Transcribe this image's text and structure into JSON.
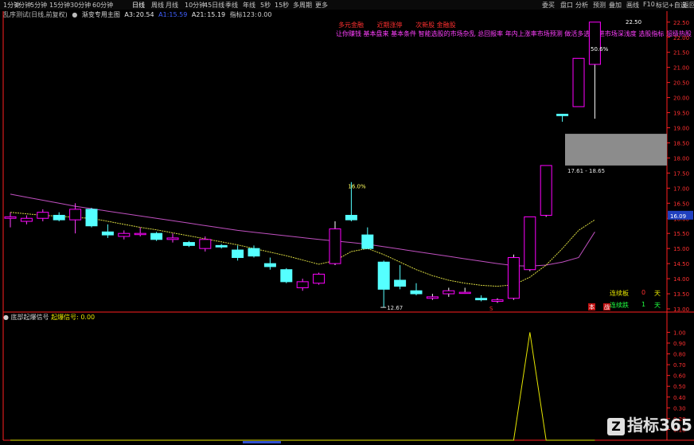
{
  "top_bar": {
    "left_tabs": [
      "1分钟",
      "1分钟",
      "5分钟",
      "15分钟",
      "30分钟",
      "60分钟",
      "日线",
      "周线",
      "月线",
      "10分钟",
      "45日线",
      "季线",
      "年线",
      "5秒",
      "15秒",
      "多周期",
      "更多"
    ],
    "right_tabs": [
      "委买",
      "盘口",
      "分析",
      "预测",
      "叠加",
      "画线",
      "F10",
      "标记",
      "+自选",
      "返回"
    ]
  },
  "title_bar": {
    "stock_name": "乱序测试(日线,前复权)",
    "indicator_name": "渐变专用主图",
    "a3_label": "A3:",
    "a3_value": "20.54",
    "mid_value": "A1:15.59",
    "a21_label": "A21:",
    "a21_value": "15.19",
    "label_four": "指标123:",
    "value_four": "0.00"
  },
  "annotations": {
    "row1": [
      "多元金融",
      "近期涨停",
      "次新股 金融股"
    ],
    "row2": "让你赚钱 基本盘来 基本条件 智能选股的市场杂乱 总回报率 年内上涨率市场预测 做活多选 就进市场深浅度 选股指标 超级热股"
  },
  "sub_panel": {
    "title": "底部起爆信号",
    "label": "起爆信号:",
    "value": "0.00"
  },
  "stats": {
    "limit_up_label": "连续板",
    "limit_up_value": "0",
    "limit_up_unit": "天",
    "limit_down_label": "连续跌",
    "limit_down_value": "1",
    "limit_down_unit": "天"
  },
  "markers": {
    "s_label": "S",
    "ben_label": "本",
    "jie_label": "战"
  },
  "logo": {
    "icon": "Z",
    "text": "指标365"
  },
  "colors": {
    "up": "#ff00ff",
    "down": "#55ffff",
    "ma_slow": "#c050c0",
    "ma_fast": "#d8d840",
    "gray_box": "#8c8c8c",
    "axis": "#ff2020",
    "signal": "#e6e600"
  },
  "chart_data": [
    {
      "type": "candlestick",
      "title": "渐变专用主图",
      "y_ticks": [
        "22.50",
        "22.00",
        "21.50",
        "21.00",
        "20.50",
        "20.00",
        "19.50",
        "19.00",
        "18.50",
        "18.00",
        "17.50",
        "17.00",
        "16.50",
        "16.00",
        "15.50",
        "15.00",
        "14.50",
        "14.00",
        "13.50",
        "13.00"
      ],
      "ylim": [
        13.0,
        22.6
      ],
      "last_price_label": "16.09",
      "candles": [
        {
          "o": 16.0,
          "h": 16.2,
          "l": 15.7,
          "c": 16.05
        },
        {
          "o": 15.9,
          "h": 16.1,
          "l": 15.8,
          "c": 16.0
        },
        {
          "o": 16.0,
          "h": 16.3,
          "l": 15.9,
          "c": 16.2
        },
        {
          "o": 16.1,
          "h": 16.2,
          "l": 15.9,
          "c": 15.95
        },
        {
          "o": 15.95,
          "h": 16.5,
          "l": 15.5,
          "c": 16.3
        },
        {
          "o": 16.3,
          "h": 16.35,
          "l": 15.7,
          "c": 15.75
        },
        {
          "o": 15.55,
          "h": 15.8,
          "l": 15.35,
          "c": 15.45
        },
        {
          "o": 15.4,
          "h": 15.6,
          "l": 15.3,
          "c": 15.5
        },
        {
          "o": 15.5,
          "h": 15.7,
          "l": 15.4,
          "c": 15.5
        },
        {
          "o": 15.5,
          "h": 15.55,
          "l": 15.25,
          "c": 15.3
        },
        {
          "o": 15.3,
          "h": 15.5,
          "l": 15.2,
          "c": 15.35
        },
        {
          "o": 15.2,
          "h": 15.25,
          "l": 15.05,
          "c": 15.1
        },
        {
          "o": 15.0,
          "h": 15.4,
          "l": 14.9,
          "c": 15.3
        },
        {
          "o": 15.1,
          "h": 15.15,
          "l": 15.0,
          "c": 15.05
        },
        {
          "o": 14.95,
          "h": 15.1,
          "l": 14.6,
          "c": 14.7
        },
        {
          "o": 15.0,
          "h": 15.1,
          "l": 14.7,
          "c": 14.75
        },
        {
          "o": 14.5,
          "h": 14.7,
          "l": 14.3,
          "c": 14.4
        },
        {
          "o": 14.3,
          "h": 14.35,
          "l": 13.85,
          "c": 13.9
        },
        {
          "o": 13.7,
          "h": 14.0,
          "l": 13.6,
          "c": 13.9
        },
        {
          "o": 13.85,
          "h": 14.2,
          "l": 13.8,
          "c": 14.15
        },
        {
          "o": 14.5,
          "h": 15.9,
          "l": 14.45,
          "c": 15.65
        },
        {
          "o": 16.1,
          "h": 17.2,
          "l": 15.9,
          "c": 15.95
        },
        {
          "o": 15.45,
          "h": 15.7,
          "l": 15.0,
          "c": 15.0
        },
        {
          "o": 14.55,
          "h": 14.6,
          "l": 13.05,
          "c": 13.65
        },
        {
          "o": 13.95,
          "h": 14.45,
          "l": 13.65,
          "c": 13.75
        },
        {
          "o": 13.6,
          "h": 13.85,
          "l": 13.45,
          "c": 13.5
        },
        {
          "o": 13.35,
          "h": 13.5,
          "l": 13.3,
          "c": 13.4
        },
        {
          "o": 13.5,
          "h": 13.7,
          "l": 13.4,
          "c": 13.6
        },
        {
          "o": 13.55,
          "h": 13.7,
          "l": 13.5,
          "c": 13.55
        },
        {
          "o": 13.35,
          "h": 13.45,
          "l": 13.25,
          "c": 13.3
        },
        {
          "o": 13.25,
          "h": 13.35,
          "l": 13.2,
          "c": 13.3
        },
        {
          "o": 13.35,
          "h": 14.8,
          "l": 13.3,
          "c": 14.7
        },
        {
          "o": 14.3,
          "h": 16.0,
          "l": 14.25,
          "c": 16.05
        },
        {
          "o": 16.1,
          "h": 17.75,
          "l": 16.05,
          "c": 17.75
        },
        {
          "o": 19.45,
          "h": 19.45,
          "l": 19.2,
          "c": 19.4
        },
        {
          "o": 19.7,
          "h": 21.3,
          "l": 19.7,
          "c": 21.3
        },
        {
          "o": 21.1,
          "h": 22.5,
          "l": 19.3,
          "c": 22.5
        }
      ],
      "ma_slow": [
        16.8,
        16.7,
        16.6,
        16.5,
        16.4,
        16.32,
        16.24,
        16.16,
        16.08,
        16.0,
        15.92,
        15.84,
        15.76,
        15.68,
        15.6,
        15.54,
        15.48,
        15.42,
        15.36,
        15.3,
        15.25,
        15.2,
        15.14,
        15.06,
        14.98,
        14.9,
        14.82,
        14.74,
        14.66,
        14.58,
        14.5,
        14.43,
        14.42,
        14.45,
        14.55,
        14.7,
        15.55
      ],
      "ma_fast": [
        16.2,
        16.15,
        16.1,
        16.07,
        16.03,
        16.0,
        15.9,
        15.8,
        15.7,
        15.62,
        15.52,
        15.42,
        15.32,
        15.22,
        15.12,
        15.0,
        14.88,
        14.76,
        14.62,
        14.48,
        14.6,
        14.9,
        15.0,
        14.8,
        14.55,
        14.3,
        14.1,
        13.95,
        13.85,
        13.78,
        13.75,
        13.8,
        14.05,
        14.45,
        15.0,
        15.6,
        15.95
      ],
      "gray_zone": [
        17.75,
        18.8
      ],
      "price_labels": [
        {
          "label": "16.0%",
          "value": 17.0
        },
        {
          "label": "12.67",
          "value": 13.05
        },
        {
          "label": "17.61 - 18.65",
          "value": 17.78
        },
        {
          "label": "50.6%",
          "value": 21.55
        },
        {
          "label": "22.50",
          "value": 22.55
        }
      ]
    },
    {
      "type": "line",
      "title": "底部起爆信号",
      "y_ticks": [
        "1.00",
        "0.90",
        "0.80",
        "0.70",
        "0.60",
        "0.50",
        "0.40",
        "0.30",
        "0.20",
        "0.10"
      ],
      "ylim": [
        0,
        1.04
      ],
      "series": [
        {
          "name": "起爆信号",
          "values": [
            0,
            0,
            0,
            0,
            0,
            0,
            0,
            0,
            0,
            0,
            0,
            0,
            0,
            0,
            0,
            0,
            0,
            0,
            0,
            0,
            0,
            0,
            0,
            0,
            0,
            0,
            0,
            0,
            0,
            0,
            0,
            0,
            1,
            0,
            0,
            0,
            0
          ]
        }
      ]
    }
  ]
}
